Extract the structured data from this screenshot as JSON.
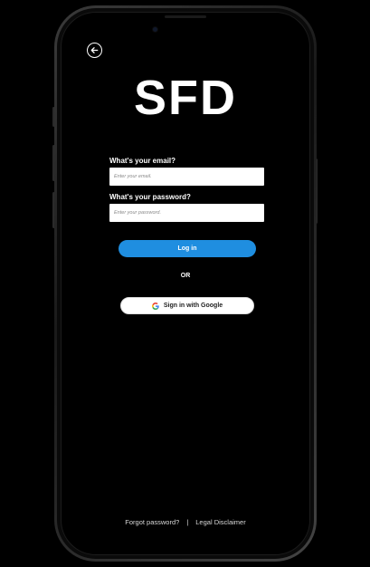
{
  "app": {
    "logo_text": "SFD"
  },
  "login_form": {
    "email_label": "What's your email?",
    "email_placeholder": "Enter your email.",
    "email_value": "",
    "password_label": "What's your password?",
    "password_placeholder": "Enter your password.",
    "password_value": "",
    "login_label": "Log in",
    "divider_text": "OR",
    "google_label": "Sign in with Google"
  },
  "footer": {
    "forgot_password": "Forgot password?",
    "separator": "|",
    "legal_disclaimer": "Legal Disclaimer"
  },
  "icons": {
    "back": "arrow-left-circle-icon",
    "google": "google-g-icon"
  },
  "colors": {
    "background": "#000000",
    "primary_button": "#1f8ee0",
    "text": "#ffffff",
    "input_background": "#ffffff"
  }
}
